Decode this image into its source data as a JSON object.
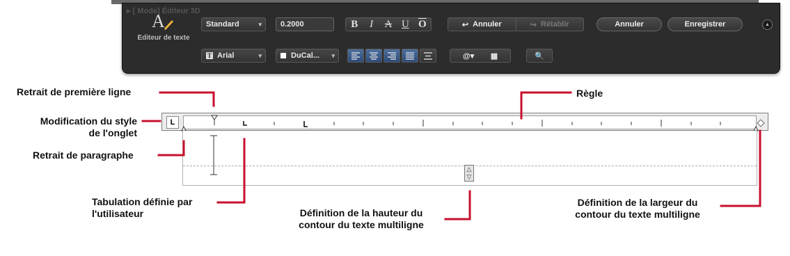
{
  "panel": {
    "header_text": "▸ [ Mode] Éditeur 3D",
    "app_label": "Editeur de texte",
    "style_select": "Standard",
    "height_input": "0.2000",
    "format_buttons": [
      "B",
      "I",
      "A",
      "U",
      "O"
    ],
    "undo_label": "Annuler",
    "redo_label": "Rétablir",
    "cancel_label": "Annuler",
    "save_label": "Enregistrer",
    "font_select": "Arial",
    "color_select": "DuCal...",
    "insert_symbol": "@"
  },
  "annotations": {
    "first_line_indent": "Retrait de première ligne",
    "ruler": "Règle",
    "tab_style_1": "Modification du style",
    "tab_style_2": "de l'onglet",
    "paragraph_indent": "Retrait de paragraphe",
    "user_tab_1": "Tabulation définie par",
    "user_tab_2": "l'utilisateur",
    "height_def_1": "Définition de la hauteur du",
    "height_def_2": "contour du texte multiligne",
    "width_def_1": "Définition de la largeur du",
    "width_def_2": "contour du texte multiligne"
  },
  "ruler": {
    "tab_style_glyph": "L"
  },
  "colors": {
    "callout_line": "#c8102e",
    "panel_bg": "#2c2c2c",
    "align_active": "#3c5f92"
  }
}
